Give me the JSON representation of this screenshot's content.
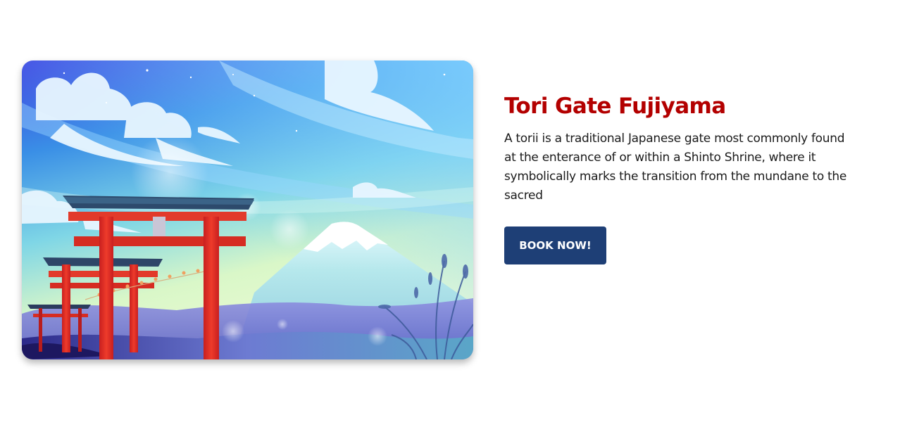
{
  "card": {
    "image_alt": "Torii gates in front of Mount Fuji illustration",
    "title": "Tori Gate Fujiyama",
    "description": "A torii is a traditional Japanese gate most commonly found at the enterance of or within a Shinto Shrine, where it symbolically marks the transition from the mundane to the sacred",
    "button_label": "BOOK NOW!"
  },
  "colors": {
    "title": "#b30000",
    "button": "#1e3f76",
    "button_text": "#ffffff",
    "body_text": "#1b1b1b",
    "background": "#ffffff"
  }
}
